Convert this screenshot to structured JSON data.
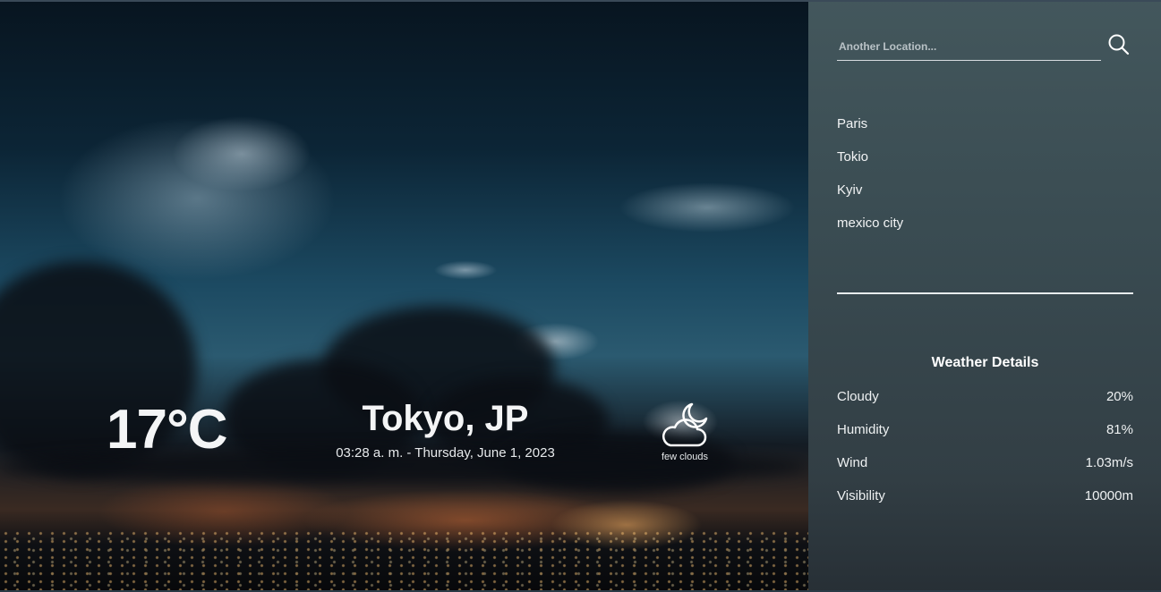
{
  "search": {
    "placeholder": "Another Location..."
  },
  "cities": [
    {
      "label": "Paris"
    },
    {
      "label": "Tokio"
    },
    {
      "label": "Kyiv"
    },
    {
      "label": "mexico city"
    }
  ],
  "details": {
    "title": "Weather Details",
    "rows": [
      {
        "label": "Cloudy",
        "value": "20%"
      },
      {
        "label": "Humidity",
        "value": "81%"
      },
      {
        "label": "Wind",
        "value": "1.03m/s"
      },
      {
        "label": "Visibility",
        "value": "10000m"
      }
    ]
  },
  "weather": {
    "temperature": "17°C",
    "location": "Tokyo, JP",
    "datetime": "03:28 a. m. - Thursday, June 1, 2023",
    "condition": "few clouds",
    "condition_icon": "cloud-moon-icon"
  },
  "icons": {
    "search": "search-icon"
  }
}
